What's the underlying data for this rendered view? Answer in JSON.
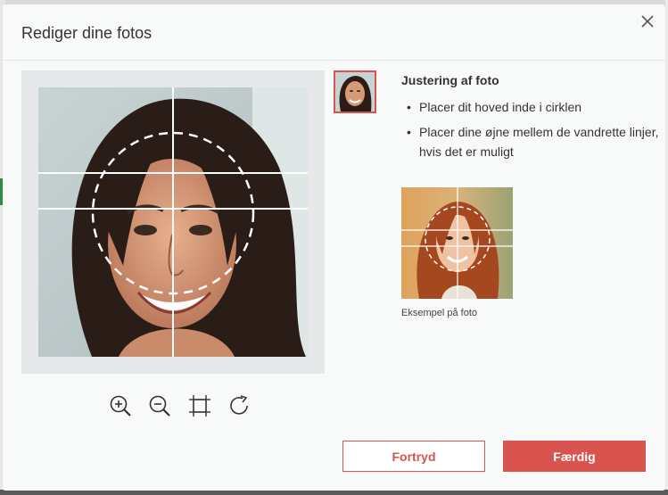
{
  "dialog": {
    "title": "Rediger dine fotos",
    "close_icon": "close-icon"
  },
  "editor": {
    "tools": [
      {
        "name": "zoom-in-icon"
      },
      {
        "name": "zoom-out-icon"
      },
      {
        "name": "crop-fit-icon"
      },
      {
        "name": "rotate-icon"
      }
    ]
  },
  "tips": {
    "heading": "Justering af foto",
    "items": [
      "Placer dit hoved inde i cirklen",
      "Placer dine øjne mellem de vandrette linjer, hvis det er muligt"
    ]
  },
  "example": {
    "caption": "Eksempel på foto"
  },
  "buttons": {
    "cancel": "Fortryd",
    "done": "Færdig"
  },
  "colors": {
    "accent": "#d9534f",
    "background": "#f8f9f9"
  }
}
